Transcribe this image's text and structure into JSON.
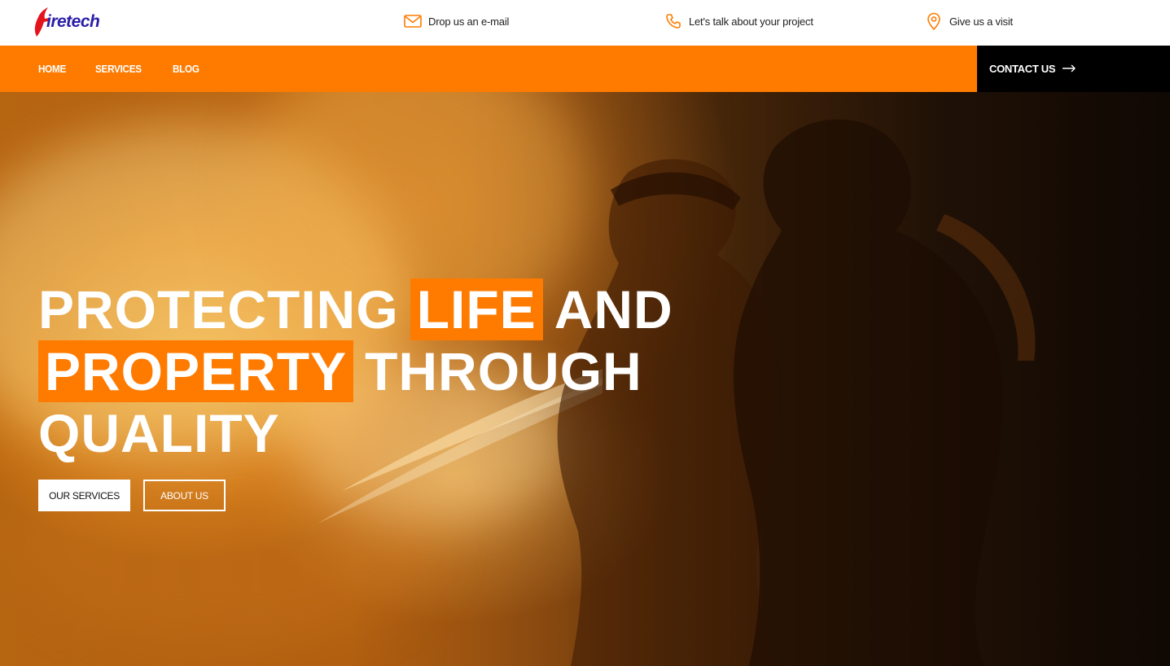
{
  "brand": {
    "logo_text": "iretech",
    "accent_color": "#ff7b00",
    "logo_color": "#2b1fa8",
    "flame_color": "#e3141c"
  },
  "topbar": {
    "items": [
      {
        "icon": "mail-icon",
        "label": "Drop us an e-mail"
      },
      {
        "icon": "phone-icon",
        "label": "Let's talk about your project"
      },
      {
        "icon": "location-pin-icon",
        "label": "Give us a visit"
      }
    ]
  },
  "nav": {
    "links": [
      {
        "label": "HOME"
      },
      {
        "label": "SERVICES"
      },
      {
        "label": "BLOG"
      }
    ],
    "cta_label": "CONTACT US",
    "cta_icon": "arrow-right-icon"
  },
  "hero": {
    "title_words": {
      "w1": "PROTECTING",
      "w2": "LIFE",
      "w3": "AND",
      "w4": "PROPERTY",
      "w5": "THROUGH",
      "w6": "QUALITY"
    },
    "primary_button": "OUR SERVICES",
    "secondary_button": "ABOUT US"
  }
}
